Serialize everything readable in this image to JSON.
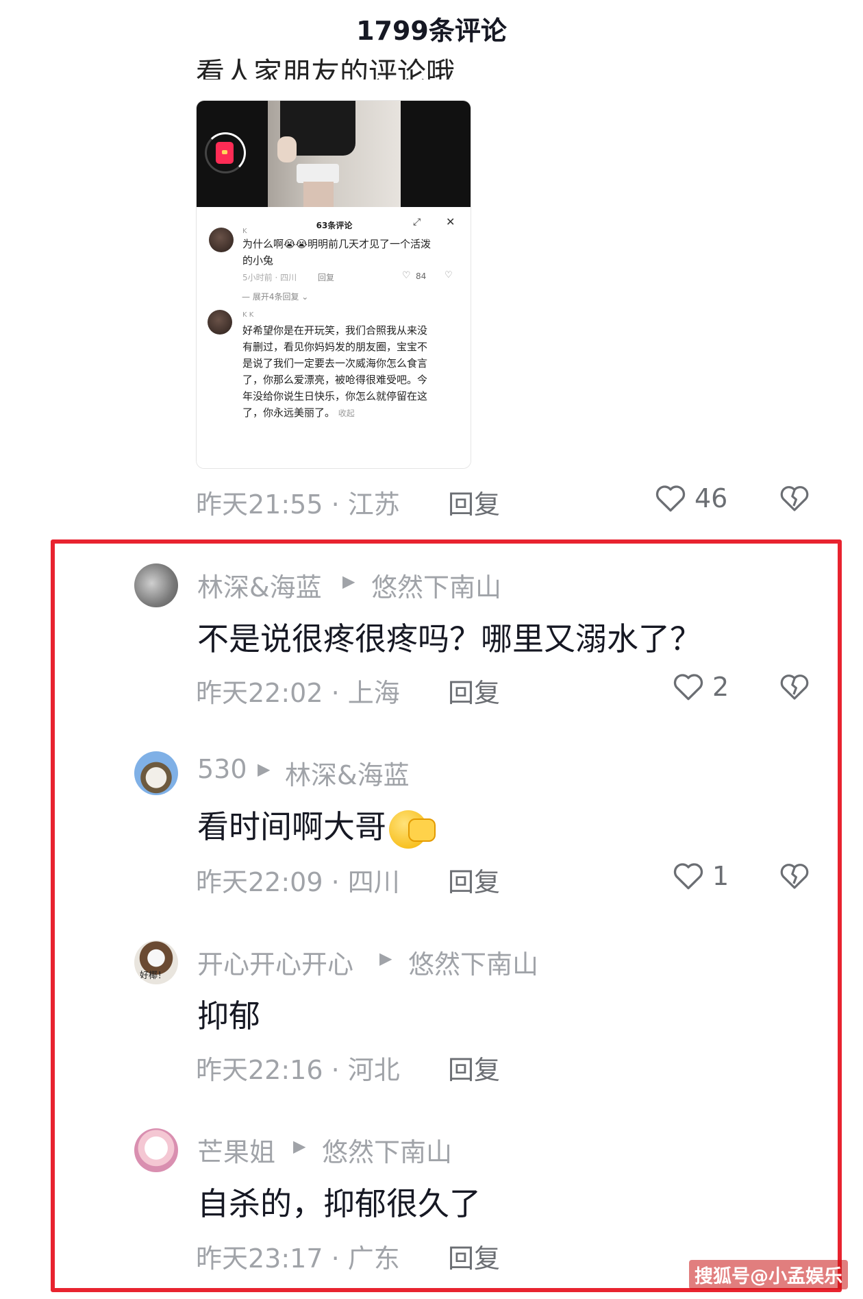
{
  "header": {
    "title": "1799条评论"
  },
  "first_comment": {
    "text_cut": "看人家朋友的评论哦",
    "time": "昨天21:55",
    "location": "江苏",
    "reply_label": "回复",
    "likes": "46"
  },
  "embedded": {
    "title": "63条评论",
    "c1": {
      "name": "K",
      "text_l1": "为什么啊😭😭明明前几天才见了一个活泼",
      "text_l2": "的小兔",
      "meta": "5小时前 · 四川",
      "reply": "回复",
      "likes": "84",
      "expand": "展开4条回复"
    },
    "c2": {
      "name": "K K",
      "lines": [
        "好希望你是在开玩笑，我们合照我从来没",
        "有删过，看见你妈妈发的朋友圈，宝宝不",
        "是说了我们一定要去一次威海你怎么食言",
        "了，你那么爱漂亮，被呛得很难受吧。今",
        "年没给你说生日快乐，你怎么就停留在这"
      ],
      "last_line": "了，你永远美丽了。",
      "collapse": "收起"
    }
  },
  "replies": [
    {
      "user": "林深&海蓝",
      "to": "悠然下南山",
      "text": "不是说很疼很疼吗？哪里又溺水了？",
      "time": "昨天22:02",
      "location": "上海",
      "reply_label": "回复",
      "likes": "2"
    },
    {
      "user": "530",
      "to": "林深&海蓝",
      "text": "看时间啊大哥",
      "time": "昨天22:09",
      "location": "四川",
      "reply_label": "回复",
      "likes": "1"
    },
    {
      "user": "开心开心开心",
      "to": "悠然下南山",
      "text": "抑郁",
      "time": "昨天22:16",
      "location": "河北",
      "reply_label": "回复",
      "avatar_text": "好椰！"
    },
    {
      "user": "芒果姐",
      "to": "悠然下南山",
      "text": "自杀的，抑郁很久了",
      "time": "昨天23:17",
      "location": "广东",
      "reply_label": "回复"
    }
  ],
  "watermark": "搜狐号@小孟娱乐",
  "colors": {
    "highlight_border": "#e8232f",
    "meta_gray": "#a0a3a8",
    "text_dark": "#161823"
  }
}
